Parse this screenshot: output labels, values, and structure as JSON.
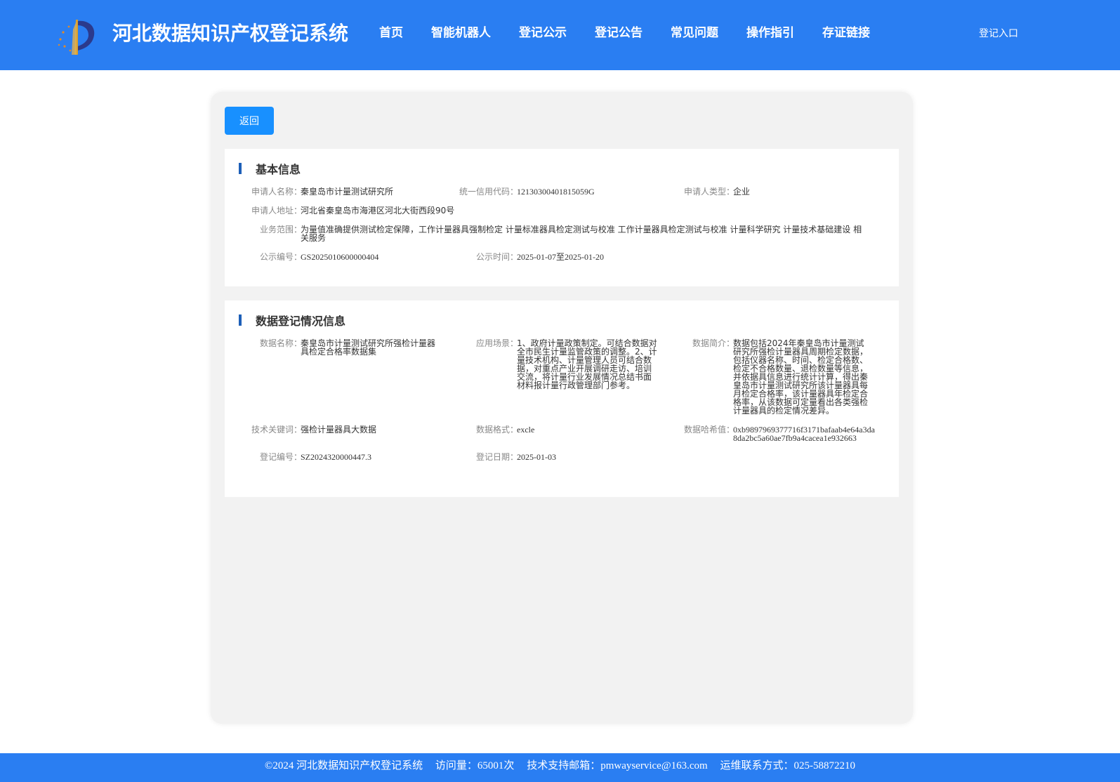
{
  "header": {
    "site_title": "河北数据知识产权登记系统",
    "nav": [
      "首页",
      "智能机器人",
      "登记公示",
      "登记公告",
      "常见问题",
      "操作指引",
      "存证链接"
    ],
    "login": "登记入口"
  },
  "back_label": "返回",
  "basic": {
    "title": "基本信息",
    "applicant_name_label": "申请人名称：",
    "applicant_name": "秦皇岛市计量测试研究所",
    "credit_code_label": "统一信用代码：",
    "credit_code": "12130300401815059G",
    "applicant_type_label": "申请人类型：",
    "applicant_type": "企业",
    "address_label": "申请人地址：",
    "address": "河北省秦皇岛市海港区河北大街西段90号",
    "scope_label": "业务范围：",
    "scope": "为量值准确提供测试检定保障，工作计量器具强制检定 计量标准器具检定测试与校准 工作计量器具检定测试与校准 计量科学研究 计量技术基础建设 相关服务",
    "pub_no_label": "公示编号：",
    "pub_no": "GS2025010600000404",
    "pub_time_label": "公示时间：",
    "pub_time": "2025-01-07至2025-01-20"
  },
  "reg": {
    "title": "数据登记情况信息",
    "data_name_label": "数据名称：",
    "data_name": "秦皇岛市计量测试研究所强检计量器具检定合格率数据集",
    "scenario_label": "应用场景：",
    "scenario": "1、政府计量政策制定。可结合数据对全市民生计量监管政策的调整。2、计量技术机构、计量管理人员可结合数据，对重点产业开展调研走访、培训交流，将计量行业发展情况总结书面材料报计量行政管理部门参考。",
    "summary_label": "数据简介：",
    "summary": "数据包括2024年秦皇岛市计量测试研究所强检计量器具周期检定数据，包括仪器名称、时间、检定合格数、检定不合格数量、退检数量等信息，并依据具信息进行统计计算，得出秦皇岛市计量测试研究所该计量器具每月检定合格率，该计量器具年检定合格率，从该数据可定量看出各类强检计量器具的检定情况差异。",
    "keywords_label": "技术关键词：",
    "keywords": "强检计量器具大数据",
    "format_label": "数据格式：",
    "format": "excle",
    "hash_label": "数据哈希值：",
    "hash": "0xb9897969377716f3171bafaab4e64a3da8da2bc5a60ae7fb9a4cacea1e932663",
    "reg_no_label": "登记编号：",
    "reg_no": "SZ2024320000447.3",
    "reg_date_label": "登记日期：",
    "reg_date": "2025-01-03"
  },
  "footer": {
    "copyright": "©2024 河北数据知识产权登记系统",
    "visits": "访问量：65001次",
    "email": "技术支持邮箱：pmwayservice@163.com",
    "phone": "运维联系方式：025-58872210"
  },
  "colors": {
    "primary": "#2a7ef2",
    "button": "#1890ff",
    "section_bar": "#1d5fb8"
  }
}
